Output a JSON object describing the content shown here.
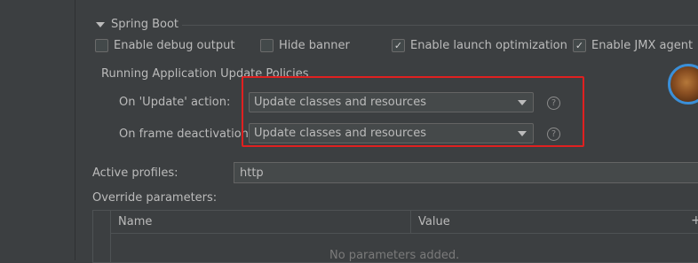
{
  "section": {
    "title": "Spring Boot"
  },
  "checkboxes": [
    {
      "label": "Enable debug output",
      "checked": false
    },
    {
      "label": "Hide banner",
      "checked": false
    },
    {
      "label": "Enable launch optimization",
      "checked": true
    },
    {
      "label": "Enable JMX agent",
      "checked": true
    }
  ],
  "update_policies": {
    "title": "Running Application Update Policies",
    "on_update": {
      "label": "On 'Update' action:",
      "value": "Update classes and resources"
    },
    "on_frame": {
      "label": "On frame deactivation:",
      "value": "Update classes and resources"
    },
    "help": "?"
  },
  "profiles": {
    "label": "Active profiles:",
    "value": "http"
  },
  "override": {
    "label": "Override parameters:",
    "columns": [
      "Name",
      "Value"
    ],
    "empty_text": "No parameters added.",
    "add_label": "+"
  },
  "colors": {
    "highlight": "#e02020",
    "accent": "#3a8fd8"
  }
}
